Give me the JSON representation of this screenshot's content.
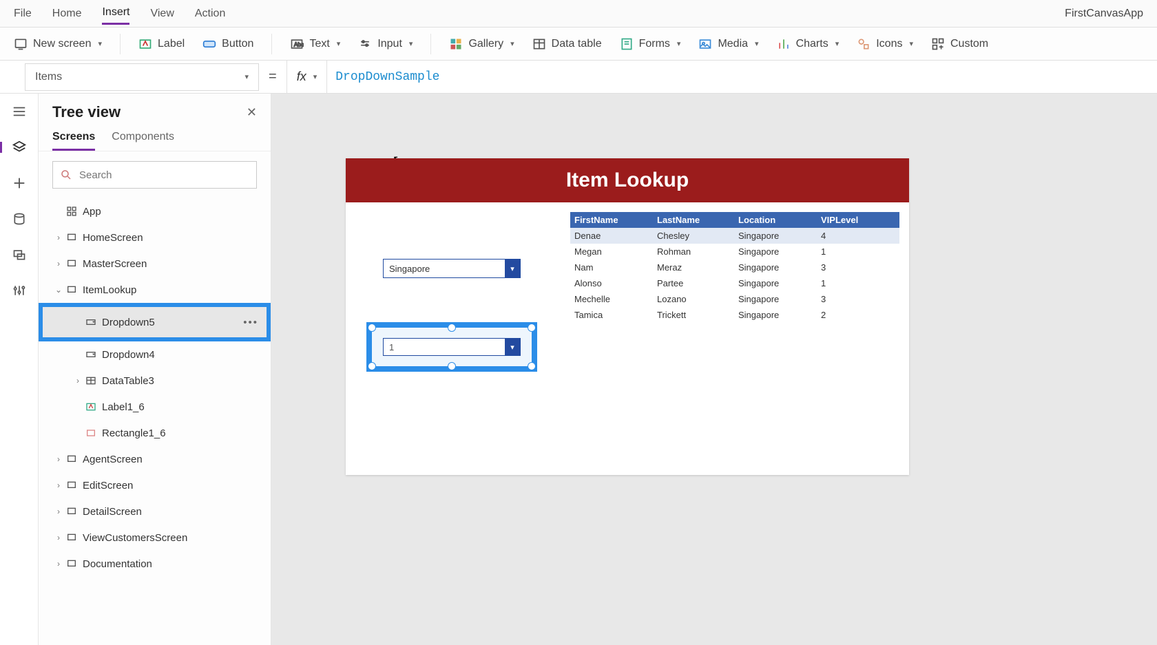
{
  "app_title": "FirstCanvasApp",
  "menu": {
    "file": "File",
    "home": "Home",
    "insert": "Insert",
    "view": "View",
    "action": "Action",
    "active": "Insert"
  },
  "ribbon": {
    "new_screen": "New screen",
    "label": "Label",
    "button": "Button",
    "text": "Text",
    "input": "Input",
    "gallery": "Gallery",
    "data_table": "Data table",
    "forms": "Forms",
    "media": "Media",
    "charts": "Charts",
    "icons": "Icons",
    "custom": "Custom"
  },
  "formula": {
    "property": "Items",
    "fx": "fx",
    "value": "DropDownSample"
  },
  "tree": {
    "title": "Tree view",
    "tab_screens": "Screens",
    "tab_components": "Components",
    "search_placeholder": "Search",
    "app": "App",
    "items": {
      "home": "HomeScreen",
      "master": "MasterScreen",
      "itemlookup": "ItemLookup",
      "dropdown5": "Dropdown5",
      "dropdown4": "Dropdown4",
      "datatable3": "DataTable3",
      "label1_6": "Label1_6",
      "rectangle1_6": "Rectangle1_6",
      "agent": "AgentScreen",
      "edit": "EditScreen",
      "detail": "DetailScreen",
      "viewcust": "ViewCustomersScreen",
      "doc": "Documentation"
    }
  },
  "canvas": {
    "header": "Item Lookup",
    "dropdown1_value": "Singapore",
    "dropdown2_value": "1",
    "table": {
      "headers": {
        "first": "FirstName",
        "last": "LastName",
        "loc": "Location",
        "vip": "VIPLevel"
      },
      "rows": [
        {
          "first": "Denae",
          "last": "Chesley",
          "loc": "Singapore",
          "vip": "4"
        },
        {
          "first": "Megan",
          "last": "Rohman",
          "loc": "Singapore",
          "vip": "1"
        },
        {
          "first": "Nam",
          "last": "Meraz",
          "loc": "Singapore",
          "vip": "3"
        },
        {
          "first": "Alonso",
          "last": "Partee",
          "loc": "Singapore",
          "vip": "1"
        },
        {
          "first": "Mechelle",
          "last": "Lozano",
          "loc": "Singapore",
          "vip": "3"
        },
        {
          "first": "Tamica",
          "last": "Trickett",
          "loc": "Singapore",
          "vip": "2"
        }
      ]
    }
  }
}
